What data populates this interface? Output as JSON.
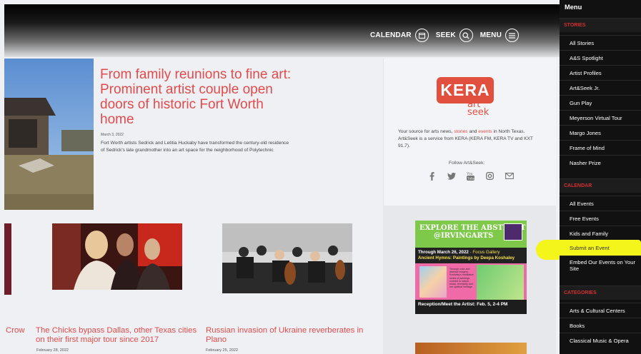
{
  "header": {
    "nav": [
      {
        "label": "CALENDAR",
        "icon": "calendar-icon"
      },
      {
        "label": "SEEK",
        "icon": "search-icon"
      },
      {
        "label": "MENU",
        "icon": "hamburger-icon"
      }
    ]
  },
  "hero": {
    "title": "From family reunions to fine art: Prominent artist couple open doors of historic Fort Worth home",
    "date": "March 3, 2022",
    "description": "Fort Worth artists Sedrick and Letitia Huckaby have transformed the century-old residence of Sedrick's late grandmother into an art space for the neighborhood of Polytechnic"
  },
  "right": {
    "logo_main": "KERA",
    "logo_art": "art",
    "logo_seek": "seek",
    "tagline_pre": "Your source for arts news, ",
    "tagline_stories": "stories",
    "tagline_mid": " and ",
    "tagline_events": "events",
    "tagline_post": " in North Texas. Art&Seek is a service from KERA (KERA FM, KERA TV and KXT 91.7).",
    "follow": "Follow Art&Seek:",
    "socials": [
      "facebook-icon",
      "twitter-icon",
      "youtube-icon",
      "instagram-icon",
      "email-icon"
    ]
  },
  "ad": {
    "headline1": "EXPLORE THE ABSTRACT",
    "headline2": "@IRVINGARTS",
    "dates": "Through March 26, 2022",
    "gallery": "Focus Gallery",
    "show": "Ancient Hymns: Paintings by Deepa Koshaley",
    "blurb": "Through color and abstract imagery, Koshaley's meditative series of paintings connect to nature, music, femininity and her spiritual heritage.",
    "reception": "Reception/Meet the Artist: Feb. 5, 2-4 PM"
  },
  "cards": [
    {
      "title": "Crow",
      "date": ""
    },
    {
      "title": "The Chicks bypass Dallas, other Texas cities on their first major tour since 2017",
      "date": "February 28, 2022"
    },
    {
      "title": "Russian invasion of Ukraine reverberates in Plano",
      "date": "February 25, 2022"
    }
  ],
  "menu": {
    "title": "Menu",
    "sections": [
      {
        "label": "STORIES",
        "items": [
          "All Stories",
          "A&S Spotlight",
          "Artist Profiles",
          "Art&Seek Jr.",
          "Gun Play",
          "Meyerson Virtual Tour",
          "Margo Jones",
          "Frame of Mind",
          "Nasher Prize"
        ]
      },
      {
        "label": "CALENDAR",
        "items": [
          "All Events",
          "Free Events",
          "Kids and Family",
          "Submit an Event",
          "Embed Our Events on Your Site"
        ]
      },
      {
        "label": "CATEGORIES",
        "items": [
          "Arts & Cultural Centers",
          "Books",
          "Classical Music & Opera"
        ]
      }
    ]
  },
  "colors": {
    "accent": "#e14b4b",
    "menu_bg": "#111111",
    "highlight": "#f4f51a"
  }
}
